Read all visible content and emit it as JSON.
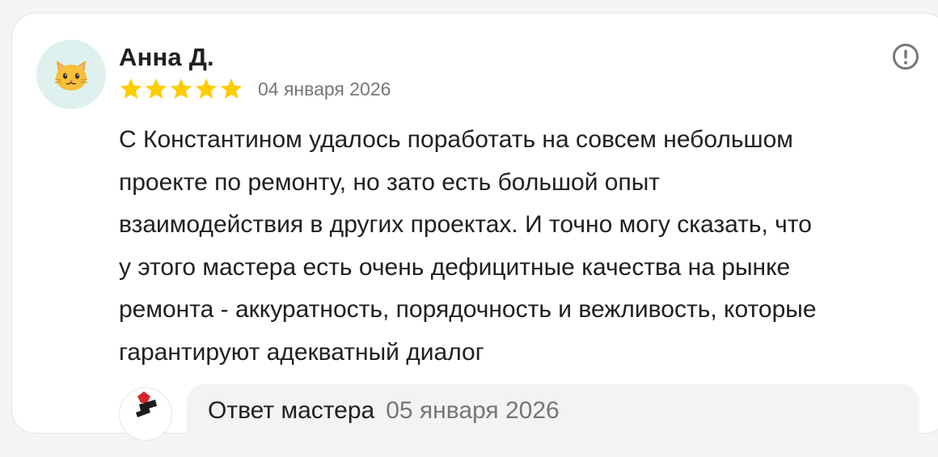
{
  "review": {
    "author": "Анна Д.",
    "avatar_icon": "cat-face-emoji",
    "rating": 5,
    "rating_max": 5,
    "star_color": "#ffcc00",
    "date": "04 января 2026",
    "text_lines": [
      "С Константином удалось поработать на совсем небольшом",
      "проекте по ремонту, но зато есть большой опыт",
      "взаимодействия в других проектах. И точно могу сказать, что",
      "у этого мастера есть очень дефицитные качества на рынке",
      "ремонта - аккуратность, порядочность и вежливость, которые",
      "гарантируют адекватный диалог"
    ],
    "report_icon": "exclamation-circle-icon"
  },
  "reply": {
    "title": "Ответ мастера",
    "date": "05 января 2026",
    "logo_icon": "master-logo-icon"
  }
}
